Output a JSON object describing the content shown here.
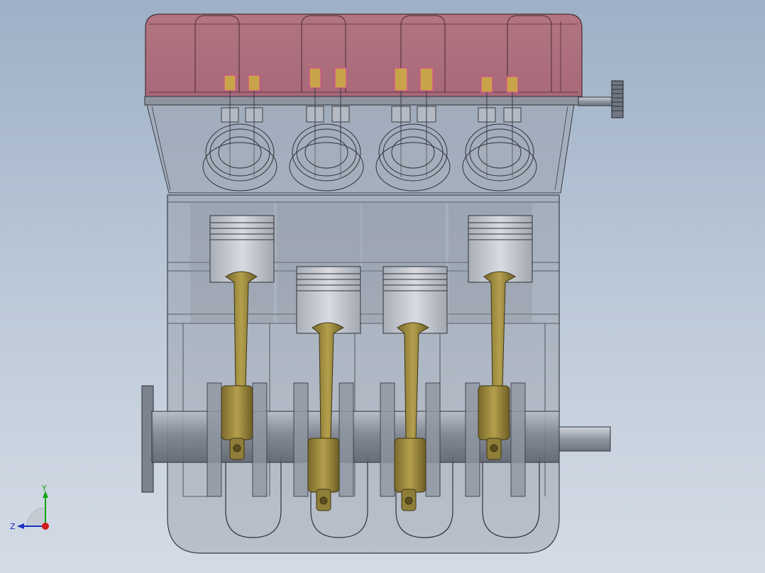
{
  "viewport": {
    "background_top": "#9eb0c6",
    "background_bottom": "#d3dbe5"
  },
  "model": {
    "cylinder_count": 4,
    "colors": {
      "valve_cover": "#b0606e",
      "block_transparent": "#8c949e",
      "piston": "#c9ccd3",
      "connecting_rod": "#9e8a3e",
      "crankshaft": "#8a8f99",
      "valve_accent": "#d6449a"
    }
  },
  "triad": {
    "x_label": "",
    "y_label": "Y",
    "z_label": "Z",
    "y_color": "#13a613",
    "z_color": "#1c2fc4",
    "origin_color": "#d11a1a"
  }
}
